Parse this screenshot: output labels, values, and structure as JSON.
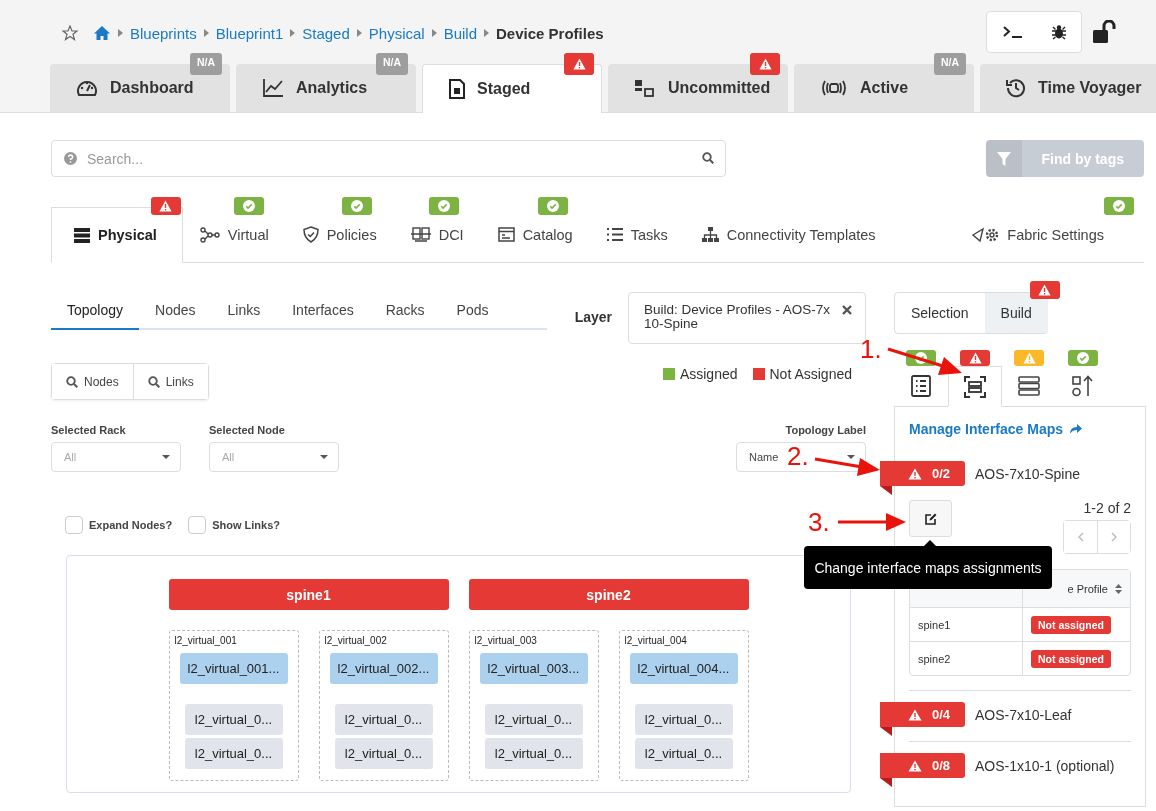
{
  "toolbar": {
    "breadcrumbs": [
      "Blueprints",
      "Blueprint1",
      "Staged",
      "Physical",
      "Build"
    ],
    "current": "Device Profiles"
  },
  "main_tabs": [
    {
      "label": "Dashboard",
      "selected": false,
      "badge": {
        "kind": "na",
        "text": "N/A"
      }
    },
    {
      "label": "Analytics",
      "selected": false,
      "badge": {
        "kind": "na",
        "text": "N/A"
      }
    },
    {
      "label": "Staged",
      "selected": true,
      "badge": {
        "kind": "error"
      }
    },
    {
      "label": "Uncommitted",
      "selected": false,
      "badge": {
        "kind": "error"
      }
    },
    {
      "label": "Active",
      "selected": false,
      "badge": {
        "kind": "na",
        "text": "N/A"
      }
    },
    {
      "label": "Time Voyager",
      "selected": false
    }
  ],
  "search": {
    "placeholder": "Search...",
    "find_button": "Find by tags",
    "find_disabled": true
  },
  "section_tabs": [
    {
      "label": "Physical",
      "selected": true,
      "badge": {
        "kind": "error"
      }
    },
    {
      "label": "Virtual",
      "selected": false,
      "badge": {
        "kind": "ok"
      }
    },
    {
      "label": "Policies",
      "selected": false,
      "badge": {
        "kind": "ok"
      }
    },
    {
      "label": "DCI",
      "selected": false,
      "badge": {
        "kind": "ok"
      }
    },
    {
      "label": "Catalog",
      "selected": false,
      "badge": {
        "kind": "ok"
      }
    },
    {
      "label": "Tasks",
      "selected": false
    },
    {
      "label": "Connectivity Templates",
      "selected": false
    },
    {
      "label": "Fabric Settings",
      "selected": false,
      "badge": {
        "kind": "ok"
      }
    }
  ],
  "sub_tabs": [
    {
      "label": "Topology",
      "selected": true
    },
    {
      "label": "Nodes",
      "selected": false
    },
    {
      "label": "Links",
      "selected": false
    },
    {
      "label": "Interfaces",
      "selected": false
    },
    {
      "label": "Racks",
      "selected": false
    },
    {
      "label": "Pods",
      "selected": false
    }
  ],
  "layer": {
    "label": "Layer",
    "value": "Build: Device Profiles - AOS-7x10-Spine"
  },
  "search_buttons": [
    "Nodes",
    "Links"
  ],
  "legend": [
    {
      "label": "Assigned",
      "color": "#7cb342"
    },
    {
      "label": "Not Assigned",
      "color": "#e53935"
    }
  ],
  "filters": [
    {
      "label": "Selected Rack",
      "placeholder": "All"
    },
    {
      "label": "Selected Node",
      "placeholder": "All"
    }
  ],
  "topology_label": {
    "label": "Topology Label",
    "value": "Name"
  },
  "checkboxes": [
    {
      "label": "Expand Nodes?",
      "checked": false
    },
    {
      "label": "Show Links?",
      "checked": false
    }
  ],
  "topology": {
    "spines": [
      {
        "name": "spine1",
        "assigned": false
      },
      {
        "name": "spine2",
        "assigned": false
      }
    ],
    "racks": [
      {
        "label": "l2_virtual_001",
        "leaf": "l2_virtual_001...",
        "servers": [
          "l2_virtual_0...",
          "l2_virtual_0..."
        ]
      },
      {
        "label": "l2_virtual_002",
        "leaf": "l2_virtual_002...",
        "servers": [
          "l2_virtual_0...",
          "l2_virtual_0..."
        ]
      },
      {
        "label": "l2_virtual_003",
        "leaf": "l2_virtual_003...",
        "servers": [
          "l2_virtual_0...",
          "l2_virtual_0..."
        ]
      },
      {
        "label": "l2_virtual_004",
        "leaf": "l2_virtual_004...",
        "servers": [
          "l2_virtual_0...",
          "l2_virtual_0..."
        ]
      }
    ]
  },
  "mode_tabs": [
    {
      "label": "Selection",
      "selected": false
    },
    {
      "label": "Build",
      "selected": true,
      "badge": {
        "kind": "error"
      }
    }
  ],
  "build_tabs": [
    {
      "selected": false,
      "badge": {
        "kind": "ok"
      }
    },
    {
      "selected": true,
      "badge": {
        "kind": "error"
      }
    },
    {
      "selected": false,
      "badge": {
        "kind": "warning"
      }
    },
    {
      "selected": false,
      "badge": {
        "kind": "ok"
      }
    }
  ],
  "panel": {
    "link": "Manage Interface Maps",
    "profiles": [
      {
        "count": "0/2",
        "name": "AOS-7x10-Spine",
        "expanded": true,
        "pagination": "1-2 of 2",
        "column_2": "e Profile",
        "rows": [
          {
            "node": "spine1",
            "status": "Not assigned"
          },
          {
            "node": "spine2",
            "status": "Not assigned"
          }
        ]
      },
      {
        "count": "0/4",
        "name": "AOS-7x10-Leaf",
        "expanded": false
      },
      {
        "count": "0/8",
        "name": "AOS-1x10-1 (optional)",
        "expanded": false
      }
    ]
  },
  "tooltip": "Change interface maps assignments",
  "annotations": [
    "1.",
    "2.",
    "3."
  ]
}
